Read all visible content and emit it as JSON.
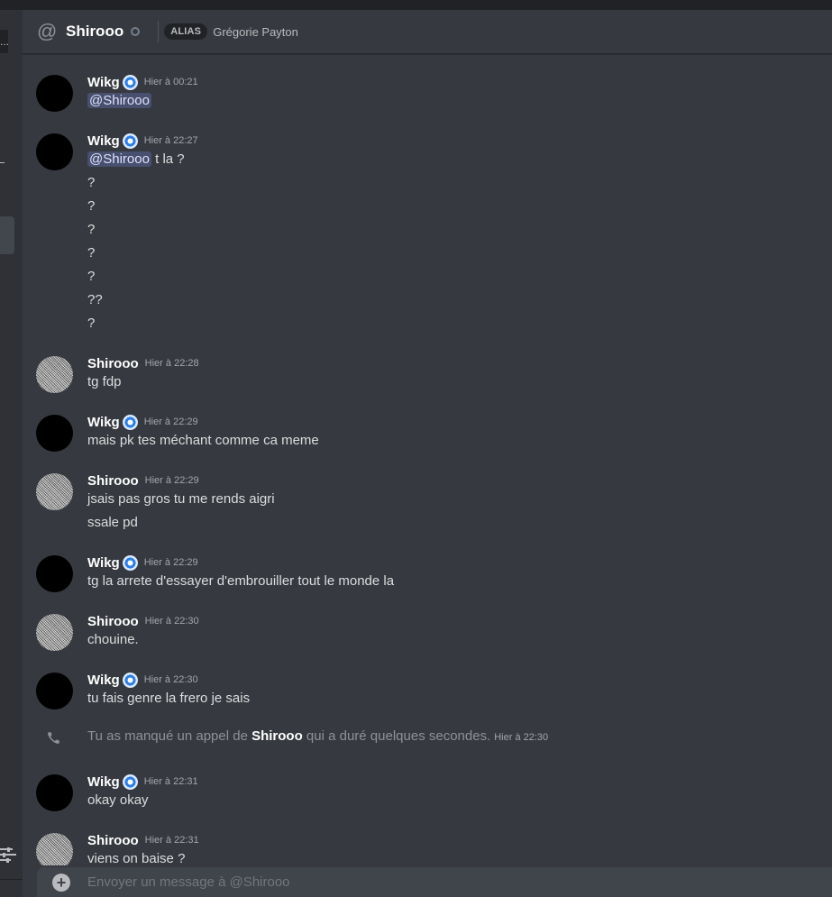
{
  "header": {
    "title": "Shirooo",
    "alias_label": "ALIAS",
    "alias_name": "Grégorie Payton"
  },
  "leftrail": {
    "more": "..."
  },
  "messages": [
    {
      "author": "Wikg",
      "badge": true,
      "avatar": "black",
      "time": "Hier à 00:21",
      "lines": [
        {
          "mention": "@Shirooo",
          "text": ""
        }
      ]
    },
    {
      "author": "Wikg",
      "badge": true,
      "avatar": "black",
      "time": "Hier à 22:27",
      "lines": [
        {
          "mention": "@Shirooo",
          "text": " t la ?"
        },
        {
          "text": "?"
        },
        {
          "text": "?"
        },
        {
          "text": "?"
        },
        {
          "text": "?"
        },
        {
          "text": "?"
        },
        {
          "text": "??"
        },
        {
          "text": "?"
        }
      ]
    },
    {
      "author": "Shirooo",
      "badge": false,
      "avatar": "noise",
      "time": "Hier à 22:28",
      "lines": [
        {
          "text": "tg fdp"
        }
      ]
    },
    {
      "author": "Wikg",
      "badge": true,
      "avatar": "black",
      "time": "Hier à 22:29",
      "lines": [
        {
          "text": "mais pk tes méchant comme ca meme"
        }
      ]
    },
    {
      "author": "Shirooo",
      "badge": false,
      "avatar": "noise",
      "time": "Hier à 22:29",
      "lines": [
        {
          "text": "jsais pas gros tu me rends aigri"
        },
        {
          "text": "ssale pd"
        }
      ]
    },
    {
      "author": "Wikg",
      "badge": true,
      "avatar": "black",
      "time": "Hier à 22:29",
      "lines": [
        {
          "text": "tg la arrete d'essayer d'embrouiller tout le monde la"
        }
      ]
    },
    {
      "author": "Shirooo",
      "badge": false,
      "avatar": "noise",
      "time": "Hier à 22:30",
      "lines": [
        {
          "text": "chouine."
        }
      ]
    },
    {
      "author": "Wikg",
      "badge": true,
      "avatar": "black",
      "time": "Hier à 22:30",
      "lines": [
        {
          "text": "tu fais genre la frero je sais"
        }
      ]
    },
    {
      "system": true,
      "icon": "missed-call-icon",
      "before": "Tu as manqué un appel de ",
      "name": "Shirooo",
      "after": " qui a duré quelques secondes.",
      "time": "Hier à 22:30"
    },
    {
      "author": "Wikg",
      "badge": true,
      "avatar": "black",
      "time": "Hier à 22:31",
      "lines": [
        {
          "text": "okay okay"
        }
      ]
    },
    {
      "author": "Shirooo",
      "badge": false,
      "avatar": "noise",
      "time": "Hier à 22:31",
      "lines": [
        {
          "text": "viens on baise ?"
        }
      ]
    }
  ],
  "composer": {
    "placeholder": "Envoyer un message à @Shirooo",
    "value": ""
  }
}
